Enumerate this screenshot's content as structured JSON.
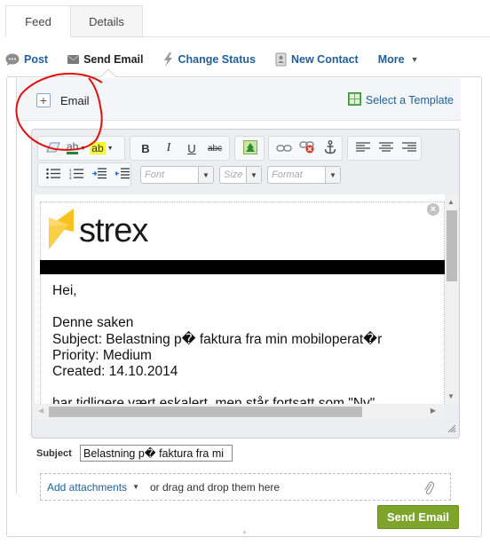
{
  "tabs": [
    {
      "label": "Feed",
      "active": true
    },
    {
      "label": "Details",
      "active": false
    }
  ],
  "actions": {
    "post": "Post",
    "send_email": "Send Email",
    "change_status": "Change Status",
    "new_contact": "New Contact",
    "more": "More"
  },
  "email_header": {
    "label": "Email",
    "template_link": "Select a Template"
  },
  "toolbar": {
    "font_placeholder": "Font",
    "size_placeholder": "Size",
    "format_placeholder": "Format",
    "bold": "B",
    "italic": "I",
    "underline": "U",
    "strike": "abc",
    "text_color": "ab",
    "highlight": "ab"
  },
  "editor": {
    "logo_text": "strex",
    "body_lines": [
      "Hei,",
      "",
      "Denne saken",
      "Subject: Belastning p� faktura fra min mobiloperat�r",
      "Priority: Medium",
      "Created: 14.10.2014",
      "",
      "har tidligere vært eskalert, men står fortsatt som \"Ny\""
    ]
  },
  "subject": {
    "label": "Subject",
    "value": "Belastning p� faktura fra mi"
  },
  "attachments": {
    "link": "Add attachments",
    "hint": "or drag and drop them here"
  },
  "send_button": "Send Email",
  "colors": {
    "link": "#1f5f9a",
    "send_button": "#7ea42c",
    "annotation": "#e01010"
  }
}
